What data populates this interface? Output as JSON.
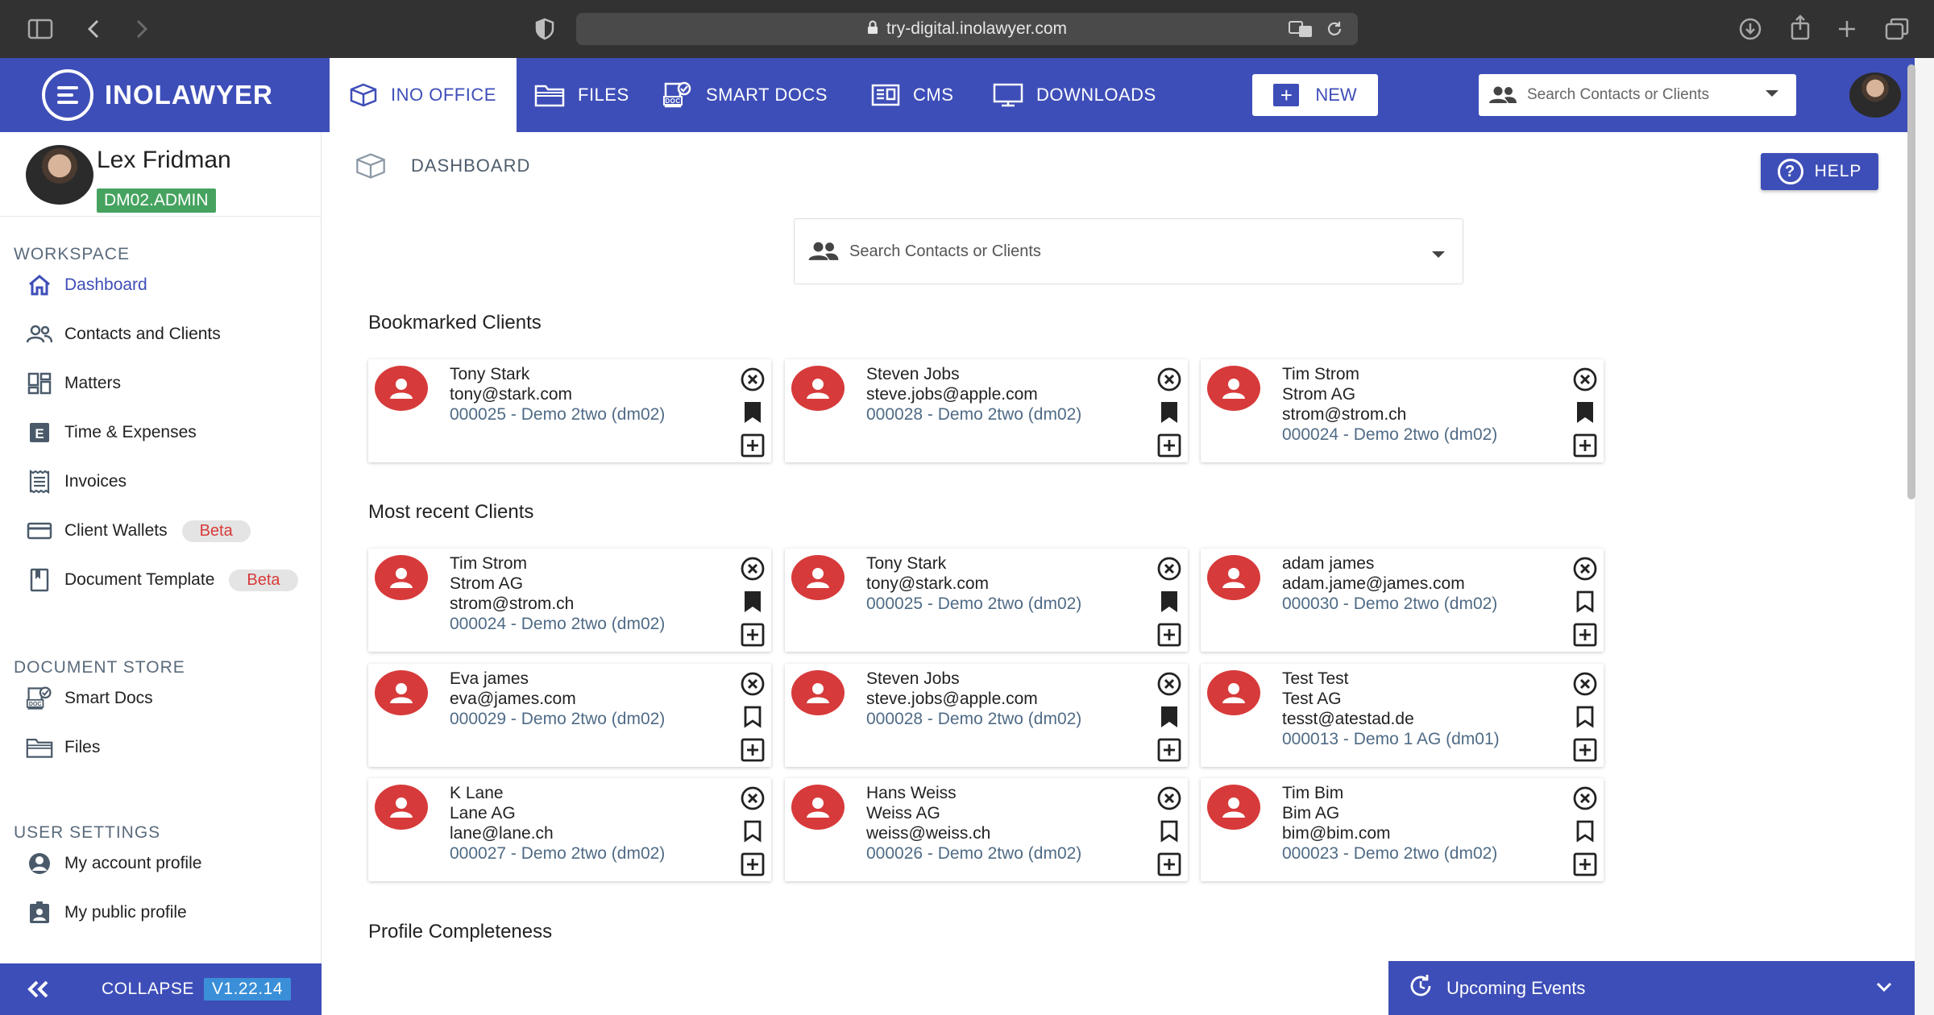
{
  "browser": {
    "url": "try-digital.inolawyer.com"
  },
  "app": {
    "logo_text": "INOLAWYER",
    "nav_tabs": [
      {
        "label": "INO OFFICE",
        "icon": "cube-icon"
      },
      {
        "label": "FILES",
        "icon": "folder-icon"
      },
      {
        "label": "SMART DOCS",
        "icon": "smart-docs-icon"
      },
      {
        "label": "CMS",
        "icon": "cms-icon"
      },
      {
        "label": "DOWNLOADS",
        "icon": "monitor-icon"
      }
    ],
    "new_label": "NEW",
    "search_placeholder": "Search Contacts or Clients",
    "accent_color": "#3e4eb8"
  },
  "sidebar": {
    "user_name": "Lex Fridman",
    "user_badge": "DM02.ADMIN",
    "workspace_title": "WORKSPACE",
    "workspace_items": [
      {
        "label": "Dashboard",
        "icon": "home-icon"
      },
      {
        "label": "Contacts and Clients",
        "icon": "contacts-icon"
      },
      {
        "label": "Matters",
        "icon": "matters-icon"
      },
      {
        "label": "Time & Expenses",
        "icon": "time-expenses-icon"
      },
      {
        "label": "Invoices",
        "icon": "invoice-icon"
      },
      {
        "label": "Client Wallets",
        "icon": "wallet-icon",
        "badge": "Beta"
      },
      {
        "label": "Document Template",
        "icon": "template-icon",
        "badge": "Beta"
      }
    ],
    "docstore_title": "DOCUMENT STORE",
    "docstore_items": [
      {
        "label": "Smart Docs",
        "icon": "smart-docs-icon"
      },
      {
        "label": "Files",
        "icon": "folder-icon"
      }
    ],
    "settings_title": "USER SETTINGS",
    "settings_items": [
      {
        "label": "My account profile",
        "icon": "account-icon"
      },
      {
        "label": "My public profile",
        "icon": "public-profile-icon"
      }
    ],
    "collapse_label": "COLLAPSE",
    "version": "V1.22.14"
  },
  "main": {
    "breadcrumb": "DASHBOARD",
    "help_label": "HELP",
    "search_placeholder": "Search Contacts or Clients",
    "bookmarked_title": "Bookmarked Clients",
    "bookmarked": [
      {
        "lines": [
          "Tony Stark",
          "tony@stark.com"
        ],
        "ref": "000025 - Demo 2two (dm02)",
        "bookmarked": true
      },
      {
        "lines": [
          "Steven Jobs",
          "steve.jobs@apple.com"
        ],
        "ref": "000028 - Demo 2two (dm02)",
        "bookmarked": true
      },
      {
        "lines": [
          "Tim Strom",
          "Strom AG",
          "strom@strom.ch"
        ],
        "ref": "000024 - Demo 2two (dm02)",
        "bookmarked": true
      }
    ],
    "recent_title": "Most recent Clients",
    "recent": [
      {
        "lines": [
          "Tim Strom",
          "Strom AG",
          "strom@strom.ch"
        ],
        "ref": "000024 - Demo 2two (dm02)",
        "bookmarked": true
      },
      {
        "lines": [
          "Tony Stark",
          "tony@stark.com"
        ],
        "ref": "000025 - Demo 2two (dm02)",
        "bookmarked": true
      },
      {
        "lines": [
          "adam james",
          "adam.jame@james.com"
        ],
        "ref": "000030 - Demo 2two (dm02)",
        "bookmarked": false
      },
      {
        "lines": [
          "Eva james",
          "eva@james.com"
        ],
        "ref": "000029 - Demo 2two (dm02)",
        "bookmarked": false
      },
      {
        "lines": [
          "Steven Jobs",
          "steve.jobs@apple.com"
        ],
        "ref": "000028 - Demo 2two (dm02)",
        "bookmarked": true
      },
      {
        "lines": [
          "Test Test",
          "Test AG",
          "tesst@atestad.de"
        ],
        "ref": "000013 - Demo 1 AG (dm01)",
        "bookmarked": false
      },
      {
        "lines": [
          "K Lane",
          "Lane AG",
          "lane@lane.ch"
        ],
        "ref": "000027 - Demo 2two (dm02)",
        "bookmarked": false
      },
      {
        "lines": [
          "Hans Weiss",
          "Weiss AG",
          "weiss@weiss.ch"
        ],
        "ref": "000026 - Demo 2two (dm02)",
        "bookmarked": false
      },
      {
        "lines": [
          "Tim Bim",
          "Bim AG",
          "bim@bim.com"
        ],
        "ref": "000023 - Demo 2two (dm02)",
        "bookmarked": false
      }
    ],
    "profile_title": "Profile Completeness",
    "events_label": "Upcoming Events"
  }
}
